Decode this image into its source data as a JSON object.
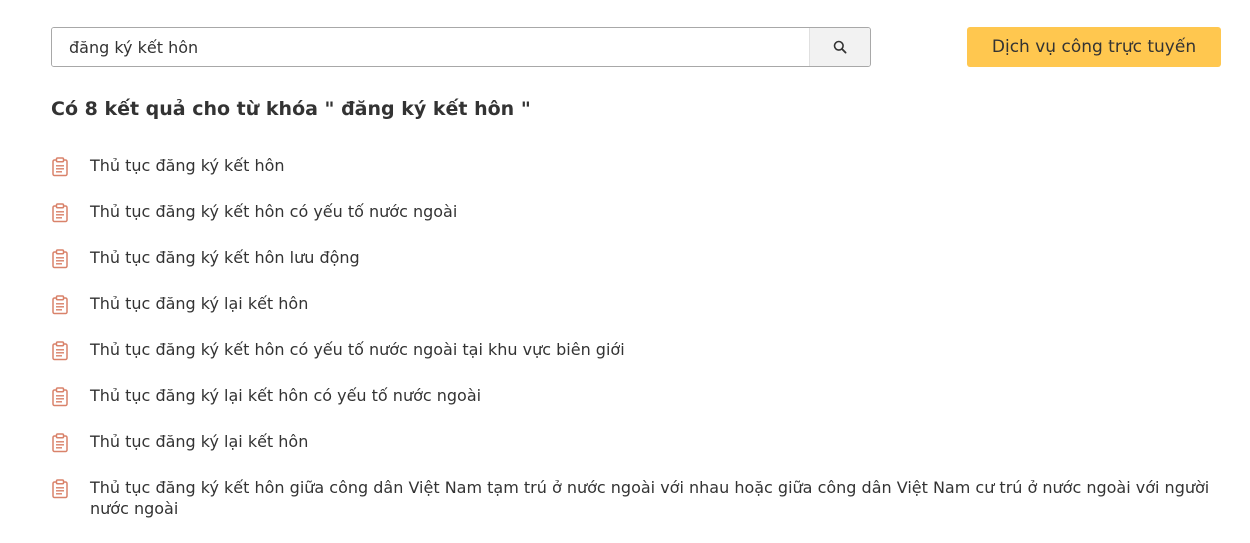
{
  "search": {
    "value": "đăng ký kết hôn",
    "placeholder": ""
  },
  "header": {
    "online_service_label": "Dịch vụ công trực tuyến"
  },
  "results": {
    "summary": "Có 8 kết quả cho từ khóa \" đăng ký kết hôn \"",
    "items": [
      "Thủ tục đăng ký kết hôn",
      "Thủ tục đăng ký kết hôn có yếu tố nước ngoài",
      "Thủ tục đăng ký kết hôn lưu động",
      "Thủ tục đăng ký lại kết hôn",
      "Thủ tục đăng ký kết hôn có yếu tố nước ngoài tại khu vực biên giới",
      "Thủ tục đăng ký lại kết hôn có yếu tố nước ngoài",
      "Thủ tục đăng ký lại kết hôn",
      "Thủ tục đăng ký kết hôn giữa công dân Việt Nam tạm trú ở nước ngoài với nhau hoặc giữa công dân Việt Nam cư trú ở nước ngoài với người nước ngoài"
    ]
  },
  "icons": {
    "search": "search-icon",
    "document": "document-icon"
  },
  "colors": {
    "accent_button": "#ffc74f",
    "document_icon": "#d9826a",
    "text": "#333333"
  }
}
